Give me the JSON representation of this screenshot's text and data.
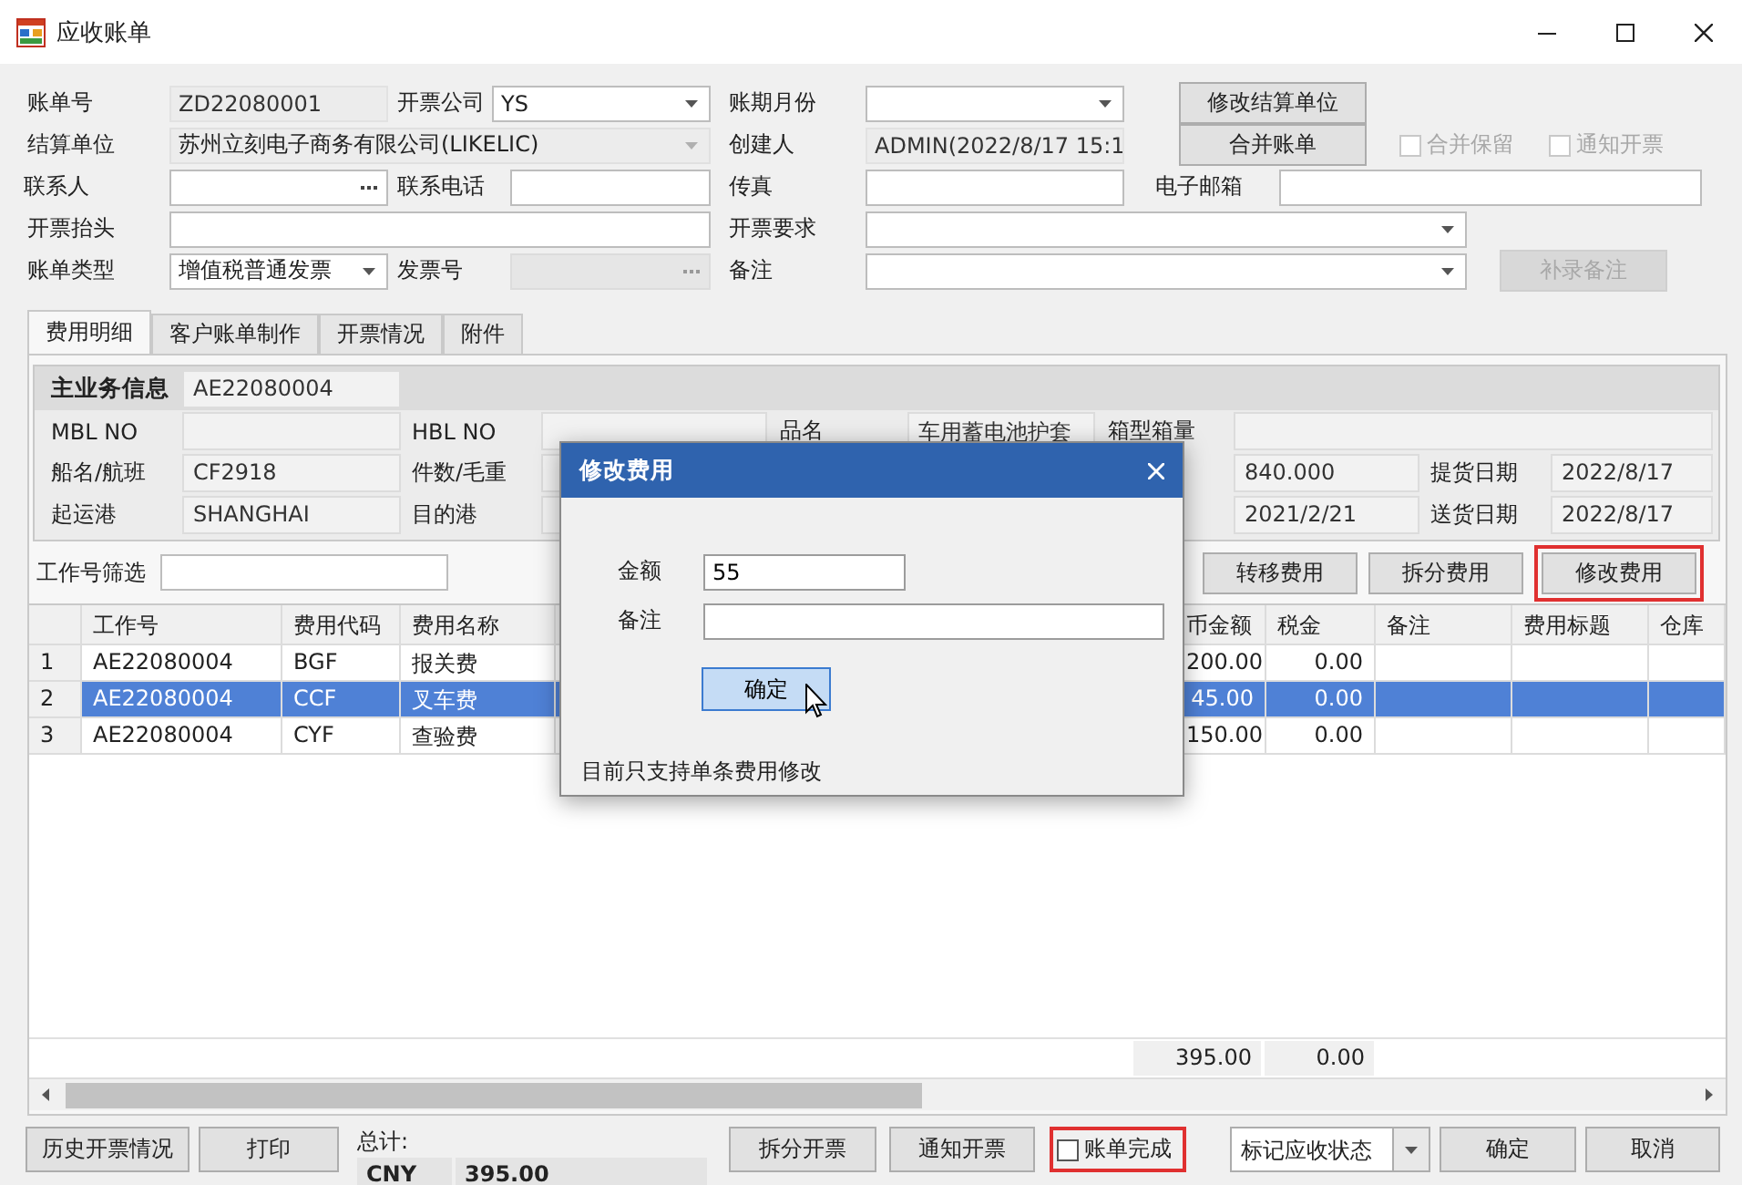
{
  "window": {
    "title": "应收账单"
  },
  "form": [
    [
      {
        "kind": "label",
        "text": "账单号"
      },
      {
        "kind": "readonly",
        "text": "ZD22080001"
      },
      {
        "kind": "label",
        "text": "开票公司"
      },
      {
        "kind": "combo",
        "text": "YS",
        "disabled": false
      },
      {
        "kind": "label",
        "text": "账期月份"
      },
      {
        "kind": "combo",
        "disabled": false
      },
      {
        "kind": "button",
        "text": "修改结算单位",
        "disabled": false
      }
    ],
    [
      {
        "kind": "label",
        "text": "结算单位"
      },
      {
        "kind": "combo",
        "text": "苏州立刻电子商务有限公司(LIKELIC)",
        "disabled": true
      },
      {
        "kind": "label",
        "text": "创建人"
      },
      {
        "kind": "readonly",
        "text": "ADMIN(2022/8/17 15:1"
      },
      {
        "kind": "button",
        "text": "合并账单",
        "disabled": false
      },
      {
        "kind": "checkbox",
        "text": "合并保留",
        "checked": false,
        "disabled": true
      },
      {
        "kind": "checkbox",
        "text": "通知开票",
        "checked": false,
        "disabled": true
      }
    ],
    [
      {
        "kind": "label",
        "text": "联系人"
      },
      {
        "kind": "lookup",
        "disabled": false
      },
      {
        "kind": "label",
        "text": "联系电话"
      },
      {
        "kind": "field"
      },
      {
        "kind": "label",
        "text": "传真"
      },
      {
        "kind": "field"
      },
      {
        "kind": "label",
        "text": "电子邮箱"
      },
      {
        "kind": "field"
      }
    ],
    [
      {
        "kind": "label",
        "text": "开票抬头"
      },
      {
        "kind": "field"
      },
      {
        "kind": "label",
        "text": "开票要求"
      },
      {
        "kind": "combo",
        "disabled": false
      }
    ],
    [
      {
        "kind": "label",
        "text": "账单类型"
      },
      {
        "kind": "combo",
        "text": "增值税普通发票",
        "disabled": false
      },
      {
        "kind": "label",
        "text": "发票号"
      },
      {
        "kind": "lookup",
        "disabled": true
      },
      {
        "kind": "label",
        "text": "备注"
      },
      {
        "kind": "combo",
        "disabled": false
      },
      {
        "kind": "button",
        "text": "补录备注",
        "disabled": true
      }
    ]
  ],
  "tabs": [
    {
      "label": "费用明细",
      "selected": true
    },
    {
      "label": "客户账单制作",
      "selected": false
    },
    {
      "label": "开票情况",
      "selected": false
    },
    {
      "label": "附件",
      "selected": false
    }
  ],
  "info": {
    "title": "主业务信息",
    "job_no": "AE22080004",
    "rows": [
      [
        {
          "label": "MBL NO"
        },
        {
          "label": "HBL NO"
        },
        {
          "label": "品名",
          "value": "车用蓄电池护套"
        },
        {
          "label": "箱型箱量"
        }
      ],
      [
        {
          "label": "船名/航班",
          "value": "CF2918"
        },
        {
          "label": "件数/毛重"
        },
        {},
        {
          "value": "840.000"
        },
        {
          "label": "提货日期",
          "value": "2022/8/17"
        }
      ],
      [
        {
          "label": "起运港",
          "value": "SHANGHAI"
        },
        {
          "label": "目的港"
        },
        {},
        {
          "value": "2021/2/21"
        },
        {
          "label": "送货日期",
          "value": "2022/8/17"
        }
      ]
    ]
  },
  "filter": {
    "label": "工作号筛选",
    "buttons": [
      {
        "text": "转移费用",
        "highlighted": false
      },
      {
        "text": "拆分费用",
        "highlighted": false
      },
      {
        "text": "修改费用",
        "highlighted": true
      }
    ]
  },
  "table": {
    "columns": [
      "工作号",
      "费用代码",
      "费用名称",
      "币金额",
      "税金",
      "备注",
      "费用标题",
      "仓库"
    ],
    "rows": [
      {
        "index": "1",
        "cells": [
          "AE22080004",
          "BGF",
          "报关费",
          "200.00",
          "0.00"
        ],
        "selected": false
      },
      {
        "index": "2",
        "cells": [
          "AE22080004",
          "CCF",
          "叉车费",
          "45.00",
          "0.00"
        ],
        "selected": true
      },
      {
        "index": "3",
        "cells": [
          "AE22080004",
          "CYF",
          "查验费",
          "150.00",
          "0.00"
        ],
        "selected": false
      }
    ],
    "totals": [
      "395.00",
      "0.00"
    ]
  },
  "bottom": {
    "left": [
      {
        "kind": "button",
        "text": "历史开票情况",
        "highlighted": false
      },
      {
        "kind": "button",
        "text": "打印",
        "highlighted": false
      }
    ],
    "total": {
      "label": "总计:",
      "currency": "CNY",
      "amount": "395.00"
    },
    "right": [
      {
        "kind": "button",
        "text": "拆分开票",
        "highlighted": false
      },
      {
        "kind": "button",
        "text": "通知开票",
        "highlighted": false
      },
      {
        "kind": "checkbox",
        "text": "账单完成",
        "checked": false,
        "highlighted": true
      },
      {
        "kind": "split-button",
        "text": "标记应收状态",
        "highlighted": false
      },
      {
        "kind": "button",
        "text": "确定",
        "highlighted": false
      },
      {
        "kind": "button",
        "text": "取消",
        "highlighted": false
      }
    ]
  },
  "dialog": {
    "title": "修改费用",
    "fields": [
      {
        "label": "金额",
        "value": "55"
      },
      {
        "label": "备注"
      }
    ],
    "ok": "确定",
    "note": "目前只支持单条费用修改"
  }
}
